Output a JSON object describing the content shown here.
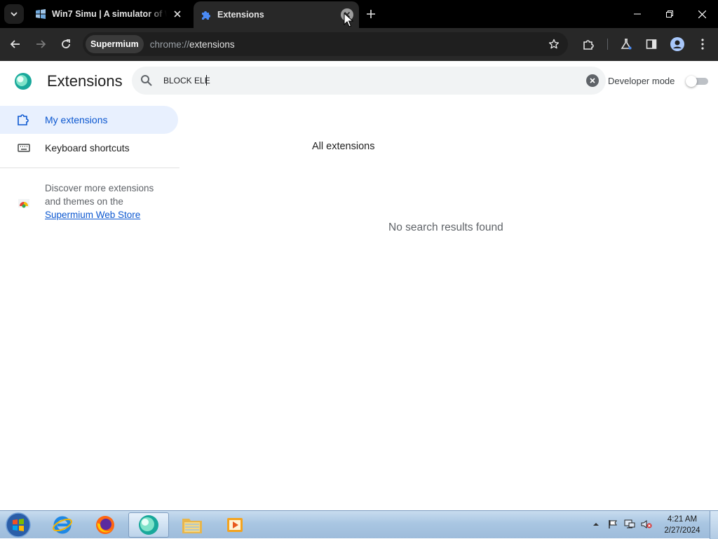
{
  "browser": {
    "tabs": [
      {
        "title": "Win7 Simu | A simulator of Windows 7",
        "favicon": "win7-logo-icon",
        "active": false
      },
      {
        "title": "Extensions",
        "favicon": "puzzle-icon",
        "active": true
      }
    ],
    "omnibox": {
      "chip": "Supermium",
      "url_scheme": "chrome://",
      "url_host": "extensions"
    }
  },
  "page": {
    "title": "Extensions",
    "search": {
      "value": "BLOCK ELE",
      "placeholder": "Search extensions"
    },
    "developer_mode": {
      "label": "Developer mode",
      "enabled": false
    },
    "nav": [
      {
        "label": "My extensions",
        "icon": "extensions-icon",
        "selected": true
      },
      {
        "label": "Keyboard shortcuts",
        "icon": "keyboard-icon",
        "selected": false
      }
    ],
    "discover": {
      "text": "Discover more extensions and themes on the",
      "link": "Supermium Web Store"
    },
    "section_title": "All extensions",
    "empty_message": "No search results found"
  },
  "taskbar": {
    "apps": [
      "internet-explorer-icon",
      "firefox-icon",
      "supermium-icon",
      "file-explorer-icon",
      "media-player-icon"
    ],
    "active_app": "supermium-icon",
    "clock": {
      "time": "4:21 AM",
      "date": "2/27/2024"
    }
  },
  "colors": {
    "accent": "#0b57d0",
    "selected_bg": "#e8f0fe",
    "chrome_dark": "#282828"
  }
}
